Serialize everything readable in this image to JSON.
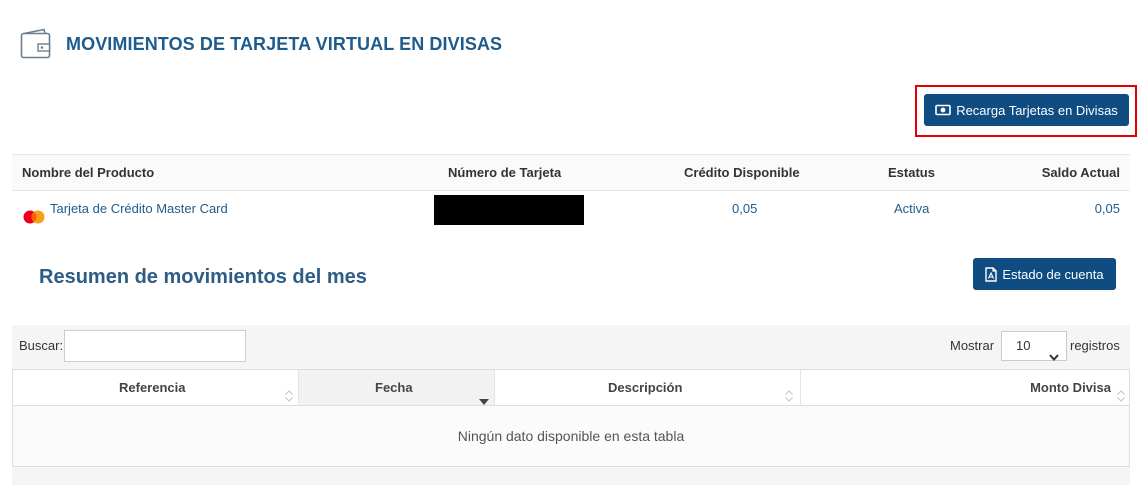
{
  "header": {
    "title": "MOVIMIENTOS DE TARJETA VIRTUAL EN DIVISAS",
    "icon": "wallet-icon"
  },
  "actions": {
    "recharge_label": "Recarga Tarjetas en Divisas",
    "recharge_icon": "money-bill-icon",
    "highlight_color": "#e60000"
  },
  "products_table": {
    "columns": [
      "Nombre del Producto",
      "Número de Tarjeta",
      "Crédito Disponible",
      "Estatus",
      "Saldo Actual"
    ],
    "rows": [
      {
        "product": "Tarjeta de Crédito Master Card",
        "product_icon": "mastercard-icon",
        "card_number": "",
        "card_number_redacted": true,
        "available_credit": "0,05",
        "status": "Activa",
        "balance": "0,05"
      }
    ]
  },
  "summary": {
    "title": "Resumen de movimientos del mes",
    "statement_label": "Estado de cuenta",
    "statement_icon": "pdf-file-icon"
  },
  "movements_table": {
    "search_label": "Buscar:",
    "search_value": "",
    "show_label": "Mostrar",
    "page_length": "10",
    "records_label": "registros",
    "columns": [
      "Referencia",
      "Fecha",
      "Descripción",
      "Monto Divisa"
    ],
    "sorted_column": "Fecha",
    "sort_direction": "descending",
    "empty_message": "Ningún dato disponible en esta tabla"
  },
  "colors": {
    "primary": "#0f4c81",
    "title": "#1f5c8c",
    "link": "#1f5c8c"
  }
}
